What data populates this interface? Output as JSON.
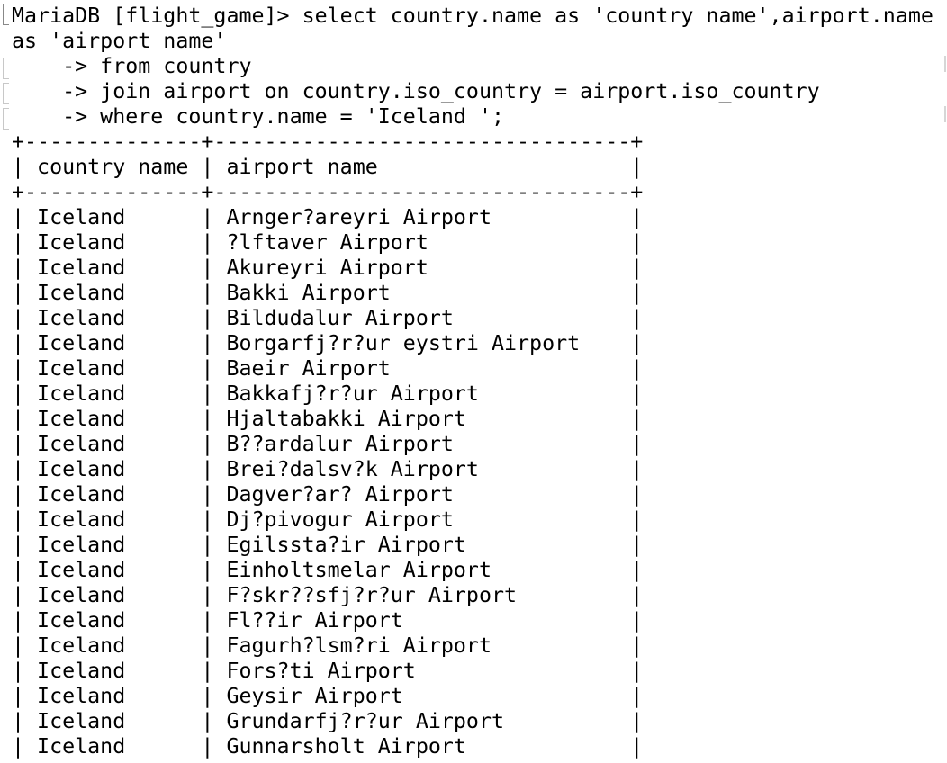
{
  "terminal": {
    "command_lines": [
      "MariaDB [flight_game]> select country.name as 'country name',airport.name",
      "as 'airport name'",
      "    -> from country",
      "    -> join airport on country.iso_country = airport.iso_country",
      "    -> where country.name = 'Iceland ';"
    ],
    "table": {
      "border": "+--------------+---------------------------------+",
      "headers": [
        "country name",
        "airport name"
      ],
      "rows": [
        [
          "Iceland",
          "Arnger?areyri Airport"
        ],
        [
          "Iceland",
          "?lftaver Airport"
        ],
        [
          "Iceland",
          "Akureyri Airport"
        ],
        [
          "Iceland",
          "Bakki Airport"
        ],
        [
          "Iceland",
          "Bildudalur Airport"
        ],
        [
          "Iceland",
          "Borgarfj?r?ur eystri Airport"
        ],
        [
          "Iceland",
          "Baeir Airport"
        ],
        [
          "Iceland",
          "Bakkafj?r?ur Airport"
        ],
        [
          "Iceland",
          "Hjaltabakki Airport"
        ],
        [
          "Iceland",
          "B??ardalur Airport"
        ],
        [
          "Iceland",
          "Brei?dalsv?k Airport"
        ],
        [
          "Iceland",
          "Dagver?ar? Airport"
        ],
        [
          "Iceland",
          "Dj?pivogur Airport"
        ],
        [
          "Iceland",
          "Egilssta?ir Airport"
        ],
        [
          "Iceland",
          "Einholtsmelar Airport"
        ],
        [
          "Iceland",
          "F?skr??sfj?r?ur Airport"
        ],
        [
          "Iceland",
          "Fl??ir Airport"
        ],
        [
          "Iceland",
          "Fagurh?lsm?ri Airport"
        ],
        [
          "Iceland",
          "Fors?ti Airport"
        ],
        [
          "Iceland",
          "Geysir Airport"
        ],
        [
          "Iceland",
          "Grundarfj?r?ur Airport"
        ],
        [
          "Iceland",
          "Gunnarsholt Airport"
        ]
      ]
    }
  }
}
